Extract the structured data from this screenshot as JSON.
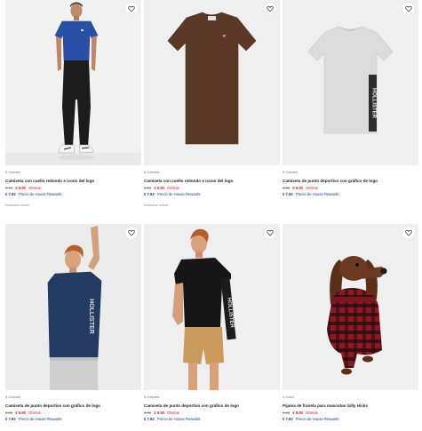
{
  "products": [
    {
      "colors": "6 Colores",
      "name": "Camiseta con cuello redondo e icono del logo",
      "old_price": "€ 16",
      "sale_price": "€ 9.90",
      "offer_label": "Ofertas",
      "rewards_price": "€ 7.92",
      "rewards_label": "Precio de House Rewards",
      "exclusive": "Exclusive online"
    },
    {
      "colors": "6 Colores",
      "name": "Camiseta con cuello redondo e icono del logo",
      "old_price": "€ 16",
      "sale_price": "€ 9.90",
      "offer_label": "Ofertas",
      "rewards_price": "€ 7.92",
      "rewards_label": "Precio de House Rewards",
      "exclusive": "Exclusive online"
    },
    {
      "colors": "5 Colores",
      "name": "Camiseta de punto deportivo con gráfico de logo",
      "old_price": "€ 22",
      "sale_price": "€ 9.90",
      "offer_label": "Ofertas",
      "rewards_price": "€ 7.92",
      "rewards_label": "Precio de House Rewards"
    },
    {
      "colors": "5 Colores",
      "name": "Camiseta de punto deportivo con gráfico de logo",
      "old_price": "€ 22",
      "sale_price": "€ 9.90",
      "offer_label": "Ofertas",
      "rewards_price": "€ 7.92",
      "rewards_label": "Precio de House Rewards"
    },
    {
      "colors": "5 Colores",
      "name": "Camiseta de punto deportivo con gráfico de logo",
      "old_price": "€ 22",
      "sale_price": "€ 9.90",
      "offer_label": "Ofertas",
      "rewards_price": "€ 7.92",
      "rewards_label": "Precio de House Rewards"
    },
    {
      "colors": "1 Color",
      "name": "Pijama de franela para mascotas Gilly Hicks",
      "old_price": "€ 22",
      "sale_price": "€ 9.90",
      "offer_label": "Ofertas",
      "rewards_price": "€ 7.92",
      "rewards_label": "Precio de House Rewards"
    }
  ],
  "shirt_print": "HOLLISTER",
  "favorite_icon": "heart-icon",
  "theme": {
    "sale_red": "#c2272d",
    "rewards_blue": "#1d3a73",
    "photo_bg": "#eeeeee"
  }
}
